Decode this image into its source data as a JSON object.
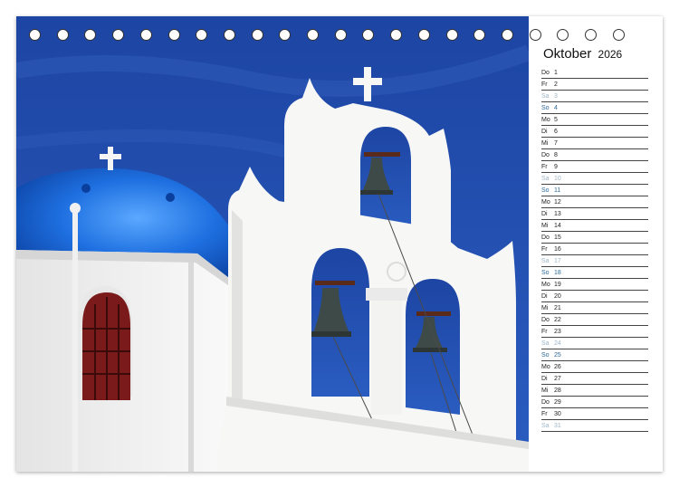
{
  "calendar": {
    "month": "Oktober",
    "year": "2026",
    "days": [
      {
        "abbr": "Do",
        "num": "1",
        "kind": "weekday"
      },
      {
        "abbr": "Fr",
        "num": "2",
        "kind": "weekday"
      },
      {
        "abbr": "Sa",
        "num": "3",
        "kind": "sat"
      },
      {
        "abbr": "So",
        "num": "4",
        "kind": "sun"
      },
      {
        "abbr": "Mo",
        "num": "5",
        "kind": "weekday"
      },
      {
        "abbr": "Di",
        "num": "6",
        "kind": "weekday"
      },
      {
        "abbr": "Mi",
        "num": "7",
        "kind": "weekday"
      },
      {
        "abbr": "Do",
        "num": "8",
        "kind": "weekday"
      },
      {
        "abbr": "Fr",
        "num": "9",
        "kind": "weekday"
      },
      {
        "abbr": "Sa",
        "num": "10",
        "kind": "sat"
      },
      {
        "abbr": "So",
        "num": "11",
        "kind": "sun"
      },
      {
        "abbr": "Mo",
        "num": "12",
        "kind": "weekday"
      },
      {
        "abbr": "Di",
        "num": "13",
        "kind": "weekday"
      },
      {
        "abbr": "Mi",
        "num": "14",
        "kind": "weekday"
      },
      {
        "abbr": "Do",
        "num": "15",
        "kind": "weekday"
      },
      {
        "abbr": "Fr",
        "num": "16",
        "kind": "weekday"
      },
      {
        "abbr": "Sa",
        "num": "17",
        "kind": "sat"
      },
      {
        "abbr": "So",
        "num": "18",
        "kind": "sun"
      },
      {
        "abbr": "Mo",
        "num": "19",
        "kind": "weekday"
      },
      {
        "abbr": "Di",
        "num": "20",
        "kind": "weekday"
      },
      {
        "abbr": "Mi",
        "num": "21",
        "kind": "weekday"
      },
      {
        "abbr": "Do",
        "num": "22",
        "kind": "weekday"
      },
      {
        "abbr": "Fr",
        "num": "23",
        "kind": "weekday"
      },
      {
        "abbr": "Sa",
        "num": "24",
        "kind": "sat"
      },
      {
        "abbr": "So",
        "num": "25",
        "kind": "sun"
      },
      {
        "abbr": "Mo",
        "num": "26",
        "kind": "weekday"
      },
      {
        "abbr": "Di",
        "num": "27",
        "kind": "weekday"
      },
      {
        "abbr": "Mi",
        "num": "28",
        "kind": "weekday"
      },
      {
        "abbr": "Do",
        "num": "29",
        "kind": "weekday"
      },
      {
        "abbr": "Fr",
        "num": "30",
        "kind": "weekday"
      },
      {
        "abbr": "Sa",
        "num": "31",
        "kind": "sat"
      }
    ]
  },
  "binding": {
    "ring_count": 22
  },
  "colors": {
    "sky": "#1f4fb0",
    "dome": "#2a74d8",
    "wall": "#f4f4f2",
    "window_frame": "#7a1a1a",
    "saturday": "#9fb6c8",
    "sunday": "#2d6a9a"
  }
}
